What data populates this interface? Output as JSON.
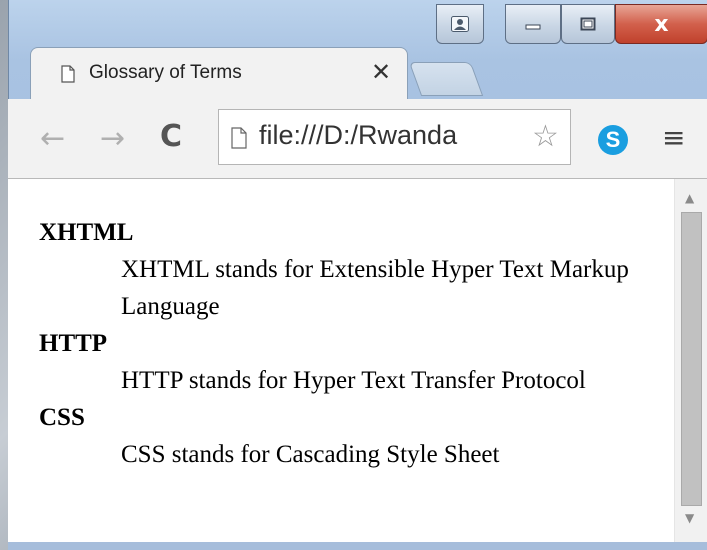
{
  "tab": {
    "title": "Glossary of Terms",
    "close_glyph": "✕",
    "icon": "page-icon"
  },
  "window": {
    "user_icon": "user-icon",
    "minimize_icon": "minimize-icon",
    "maximize_icon": "maximize-icon",
    "close_glyph": "x"
  },
  "toolbar": {
    "back_glyph": "←",
    "forward_glyph": "→",
    "reload_glyph": "C",
    "url": "file:///D:/Rwanda",
    "star_glyph": "☆",
    "skype_label": "S",
    "menu_glyph": "≡"
  },
  "glossary": [
    {
      "term": "XHTML",
      "definition": "XHTML stands for Extensible Hyper Text Markup Language"
    },
    {
      "term": "HTTP",
      "definition": "HTTP stands for Hyper Text Transfer Protocol"
    },
    {
      "term": "CSS",
      "definition": "CSS stands for Cascading Style Sheet"
    }
  ],
  "scrollbar": {
    "up_glyph": "▲",
    "down_glyph": "▼"
  },
  "colors": {
    "close_button": "#c0412c",
    "skype": "#1a9ee0"
  }
}
